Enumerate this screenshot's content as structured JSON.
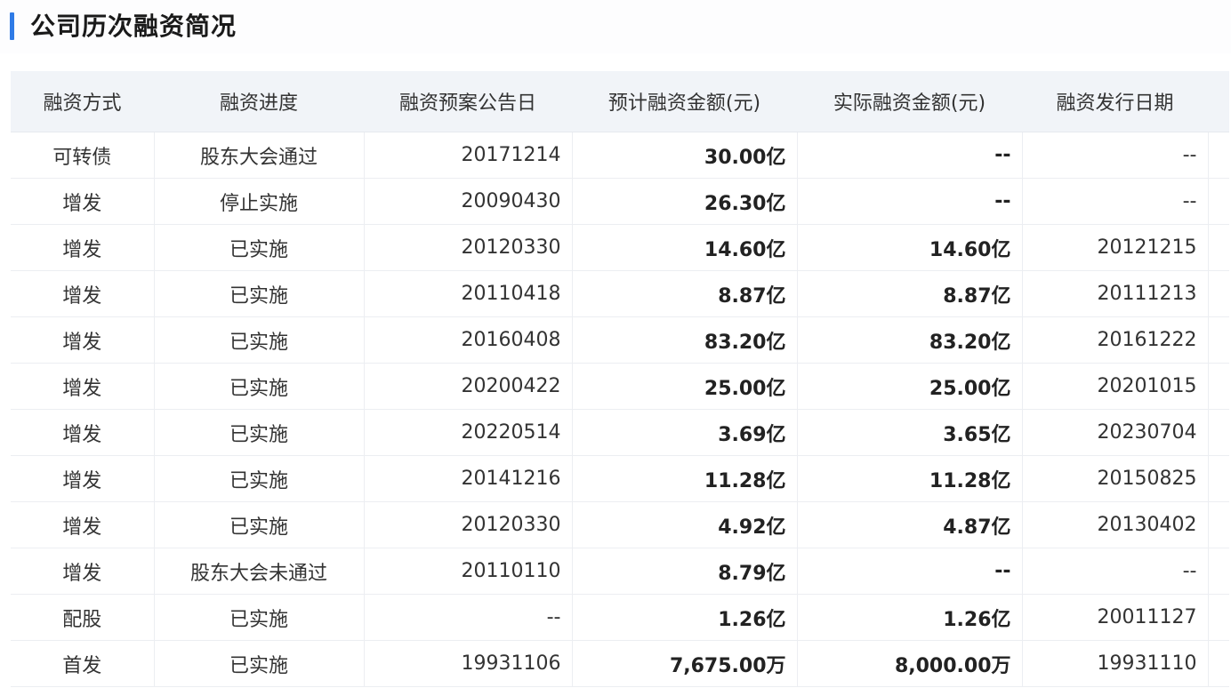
{
  "header": {
    "title": "公司历次融资简况",
    "accent_color": "#2f7be6"
  },
  "table": {
    "columns": [
      "融资方式",
      "融资进度",
      "融资预案公告日",
      "预计融资金额(元)",
      "实际融资金额(元)",
      "融资发行日期"
    ],
    "rows": [
      [
        "可转债",
        "股东大会通过",
        "20171214",
        "30.00亿",
        "--",
        "--"
      ],
      [
        "增发",
        "停止实施",
        "20090430",
        "26.30亿",
        "--",
        "--"
      ],
      [
        "增发",
        "已实施",
        "20120330",
        "14.60亿",
        "14.60亿",
        "20121215"
      ],
      [
        "增发",
        "已实施",
        "20110418",
        "8.87亿",
        "8.87亿",
        "20111213"
      ],
      [
        "增发",
        "已实施",
        "20160408",
        "83.20亿",
        "83.20亿",
        "20161222"
      ],
      [
        "增发",
        "已实施",
        "20200422",
        "25.00亿",
        "25.00亿",
        "20201015"
      ],
      [
        "增发",
        "已实施",
        "20220514",
        "3.69亿",
        "3.65亿",
        "20230704"
      ],
      [
        "增发",
        "已实施",
        "20141216",
        "11.28亿",
        "11.28亿",
        "20150825"
      ],
      [
        "增发",
        "已实施",
        "20120330",
        "4.92亿",
        "4.87亿",
        "20130402"
      ],
      [
        "增发",
        "股东大会未通过",
        "20110110",
        "8.79亿",
        "--",
        "--"
      ],
      [
        "配股",
        "已实施",
        "--",
        "1.26亿",
        "1.26亿",
        "20011127"
      ],
      [
        "首发",
        "已实施",
        "19931106",
        "7,675.00万",
        "8,000.00万",
        "19931110"
      ]
    ]
  }
}
